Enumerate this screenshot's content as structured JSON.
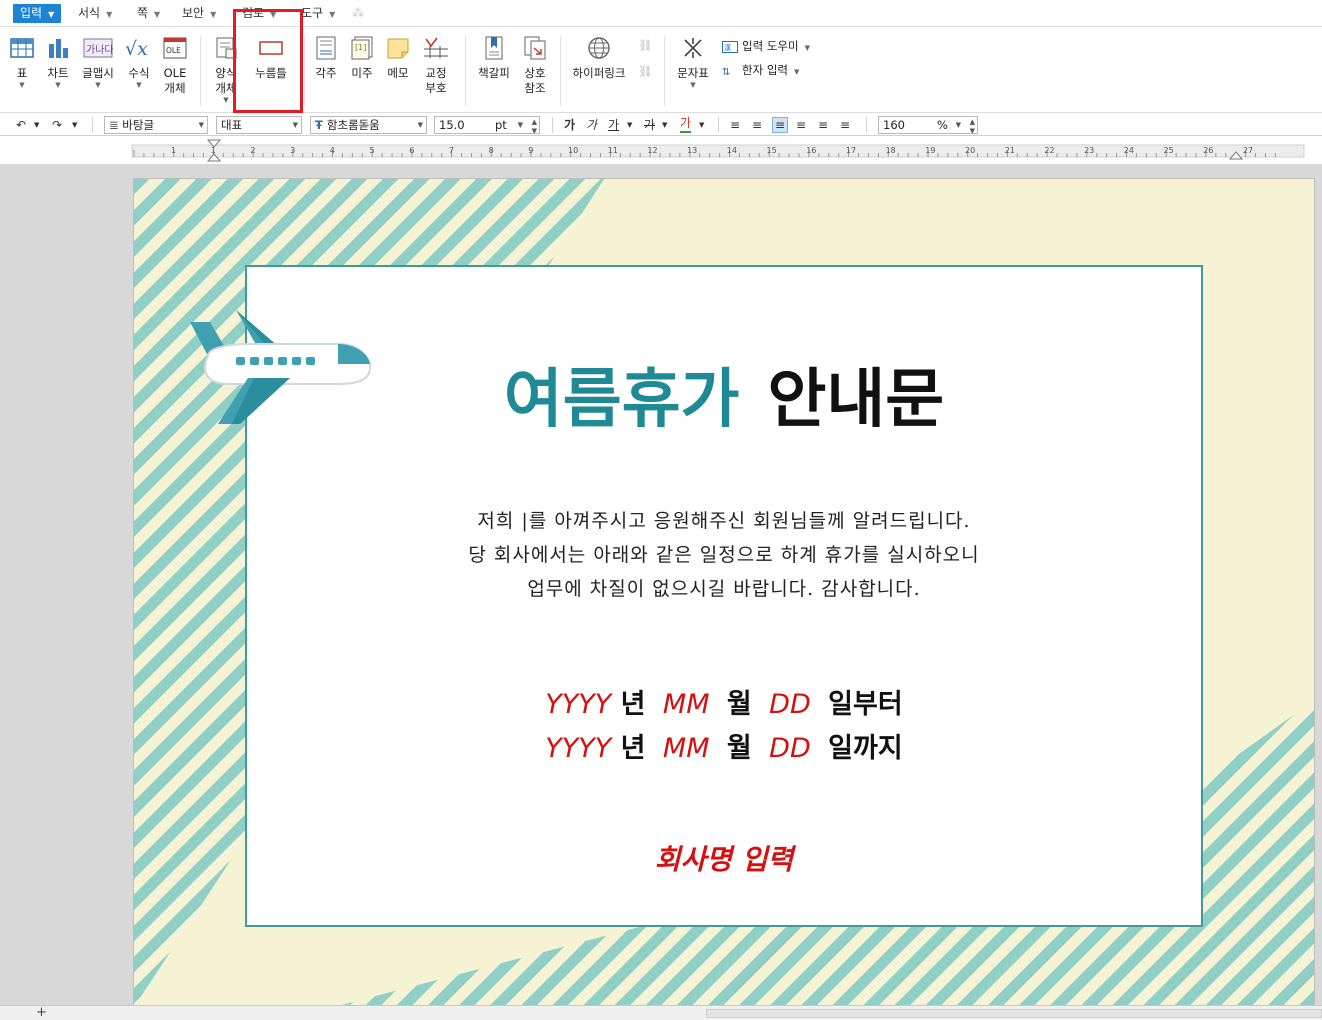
{
  "menubar": {
    "items": [
      "입력",
      "서식",
      "쪽",
      "보안",
      "검토",
      "도구"
    ],
    "active_index": 0
  },
  "ribbon": {
    "buttons": [
      {
        "name": "table",
        "label": "표",
        "icon": "table-icon",
        "has_dropdown": true
      },
      {
        "name": "chart",
        "label": "차트",
        "icon": "bar-chart-icon",
        "has_dropdown": true
      },
      {
        "name": "glyph",
        "label": "글맵시",
        "icon": "wordart-icon",
        "has_dropdown": true
      },
      {
        "name": "formula",
        "label": "수식",
        "icon": "sqrt-icon",
        "has_dropdown": true
      },
      {
        "name": "ole",
        "label_1": "OLE",
        "label_2": "개체",
        "icon": "ole-icon"
      },
      {
        "name": "form",
        "label_1": "양식",
        "label_2": "개체",
        "icon": "form-icon",
        "has_dropdown": true
      },
      {
        "name": "button",
        "label": "누름틀",
        "icon": "field-box-icon"
      },
      {
        "name": "footnote",
        "label": "각주",
        "icon": "footnote-icon"
      },
      {
        "name": "endnote",
        "label": "미주",
        "icon": "endnote-icon"
      },
      {
        "name": "memo",
        "label": "메모",
        "icon": "memo-icon"
      },
      {
        "name": "proof",
        "label_1": "교정",
        "label_2": "부호",
        "icon": "proof-mark-icon",
        "has_dropdown": true
      },
      {
        "name": "bookmark",
        "label": "책갈피",
        "icon": "bookmark-icon"
      },
      {
        "name": "crossref",
        "label_1": "상호",
        "label_2": "참조",
        "icon": "cross-reference-icon"
      },
      {
        "name": "hyperlink",
        "label": "하이퍼링크",
        "icon": "globe-link-icon"
      },
      {
        "name": "symbol",
        "label": "문자표",
        "icon": "special-char-icon",
        "has_dropdown": true
      }
    ],
    "small_items": [
      {
        "label": "입력 도우미",
        "icon": "input-helper-icon"
      },
      {
        "label": "한자 입력",
        "icon": "hanja-icon"
      }
    ]
  },
  "format_toolbar": {
    "style": "바탕글",
    "language": "대표",
    "font": "함초롬돋움",
    "font_size": "15.0",
    "size_unit": "pt",
    "char_styles": [
      "가",
      "가",
      "가",
      "가",
      "가"
    ],
    "zoom": "160",
    "zoom_unit": "%"
  },
  "ruler": {
    "labels": [
      "1",
      "1",
      "2",
      "3",
      "4",
      "5",
      "6",
      "7",
      "8",
      "9",
      "10",
      "11",
      "12",
      "13",
      "14",
      "15",
      "16",
      "17",
      "18",
      "19",
      "20",
      "21",
      "22",
      "23",
      "24",
      "25",
      "26",
      "27"
    ]
  },
  "document": {
    "title_part1": "여름휴가",
    "title_part2": "안내문",
    "body_lines": [
      "저희 |를 아껴주시고 응원해주신 회원님들께 알려드립니다.",
      "당 회사에서는 아래와 같은 일정으로 하계 휴가를 실시하오니",
      "업무에 차질이 없으시길 바랍니다. 감사합니다."
    ],
    "date_from": {
      "year": "YYYY",
      "year_unit": "년",
      "month": "MM",
      "month_unit": "월",
      "day": "DD",
      "day_unit": "일부터"
    },
    "date_to": {
      "year": "YYYY",
      "year_unit": "년",
      "month": "MM",
      "month_unit": "월",
      "day": "DD",
      "day_unit": "일까지"
    },
    "company": "회사명 입력"
  },
  "colors": {
    "accent": "#1c83d6",
    "title_teal": "#1f8a96",
    "stripe": "#8fcfc6",
    "background_cream": "#f6f2d4",
    "placeholder_red": "#d60f0f",
    "highlight_red": "#e21c24"
  },
  "statusbar": {
    "add_tab": "+"
  }
}
